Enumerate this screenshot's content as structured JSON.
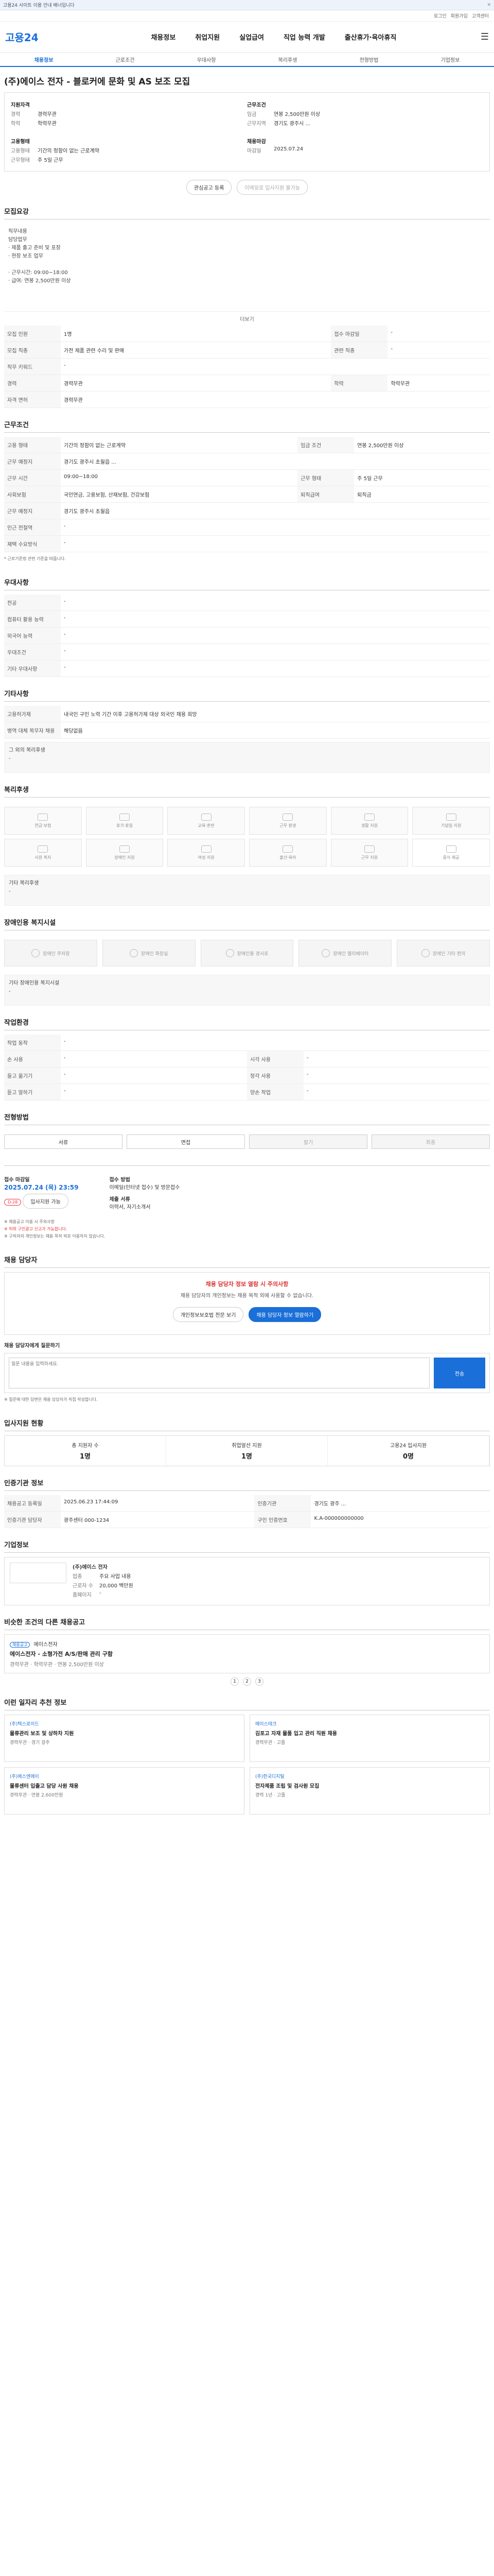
{
  "banner": {
    "text": "고용24 사이트 이용 안내 배너입니다"
  },
  "util": {
    "links": [
      "로그인",
      "회원가입",
      "고객센터"
    ]
  },
  "gnb": {
    "logo": "고용24",
    "menus": [
      "채용정보",
      "취업지원",
      "실업급여",
      "직업 능력 개발",
      "출산휴가·육아휴직"
    ]
  },
  "subnav": [
    "채용정보",
    "근로조건",
    "우대사항",
    "복리후생",
    "전형방법",
    "기업정보"
  ],
  "job": {
    "title": "(주)에이스 전자 - 블로커에 문화 및 AS 보조 모집",
    "left": [
      [
        "지원자격",
        ""
      ],
      [
        "경력",
        "경력무관"
      ],
      [
        "학력",
        "학력무관"
      ]
    ],
    "right": [
      [
        "근무조건",
        ""
      ],
      [
        "임금",
        "연봉 2,500만원 이상"
      ],
      [
        "근무지역",
        "경기도 광주시 ..."
      ]
    ],
    "left2": [
      [
        "고용형태",
        ""
      ],
      [
        "고용형태",
        "기간의 정함이 없는 근로계약"
      ],
      [
        "근무형태",
        "주 5일 근무"
      ]
    ],
    "right2": [
      [
        "채용마감",
        ""
      ],
      [
        "마감일",
        "2025.07.24"
      ]
    ],
    "btn_interest": "관심공고 등록",
    "btn_print": "이메일로 입사지원 불가능"
  },
  "recruit": {
    "heading": "모집요강",
    "summary": "직무내용\n담당업무\n· 제품 출고 준비 및 포장\n· 현장 보조 업무\n\n· 근무시간: 09:00~18:00\n· 급여: 연봉 2,500만원 이상",
    "more": "더보기",
    "rows": [
      [
        "모집 인원",
        "1명",
        "접수 마감일",
        "-"
      ],
      [
        "모집 직종",
        "가전 제품 관련 수리 및 판매",
        "관련 직종",
        "-"
      ],
      [
        "직무 키워드",
        "-",
        "",
        ""
      ],
      [
        "경력",
        "경력무관",
        "학력",
        "학력무관"
      ],
      [
        "자격 면허",
        "경력무관",
        "",
        ""
      ]
    ]
  },
  "cond": {
    "heading": "근무조건",
    "rows": [
      [
        "고용 형태",
        "기간의 정함이 없는 근로계약",
        "임금 조건",
        "연봉 2,500만원 이상"
      ],
      [
        "근무 예정지",
        "경기도 광주시 초월읍 ...",
        "",
        ""
      ],
      [
        "근무 시간",
        "09:00~18:00",
        "근무 형태",
        "주 5일 근무"
      ],
      [
        "사회보험",
        "국민연금, 고용보험, 산재보험, 건강보험",
        "퇴직급여",
        "퇴직금"
      ],
      [
        "근무 예정지",
        "경기도 광주시 초월읍",
        "",
        ""
      ],
      [
        "인근 전철역",
        "-",
        "",
        ""
      ],
      [
        "재택 수요방식",
        "-",
        "",
        ""
      ]
    ],
    "note": "* 근로기준법 관련 기준을 따릅니다."
  },
  "pref": {
    "heading": "우대사항",
    "rows": [
      [
        "전공",
        "-"
      ],
      [
        "컴퓨터 활용 능력",
        "-"
      ],
      [
        "외국어 능력",
        "-"
      ],
      [
        "우대조건",
        "-"
      ],
      [
        "기타 우대사항",
        "-"
      ]
    ]
  },
  "etc": {
    "heading": "기타사항",
    "rows": [
      [
        "고용허가제",
        "내국인 구인 노력 기간 이후 고용허가제 대상 외국인 채용 희망"
      ],
      [
        "병역 대체 복무자 채용",
        "해당없음"
      ]
    ],
    "extra": "그 외의 복리후생\n-"
  },
  "welfare": {
    "heading": "복리후생",
    "items": [
      "연금·보험",
      "휴가·휴일",
      "교육·훈련",
      "근무 환경",
      "생활 지원",
      "기념일 지원",
      "사원 복지",
      "장애인 지원",
      "여성 지원",
      "출산·육아",
      "근무 지원",
      "중식 제공"
    ],
    "extra": "기타 복리후생\n-"
  },
  "disab": {
    "heading": "장애인용 복지시설",
    "items": [
      "장애인 주차장",
      "장애인 화장실",
      "장애인용 경사로",
      "장애인 엘리베이터",
      "장애인 기타 편의"
    ],
    "extra": "기타 장애인용 복지시설\n-"
  },
  "env": {
    "heading": "작업환경",
    "rows": [
      [
        "작업 동작",
        "-",
        ""
      ],
      [
        "손 사용",
        "-",
        "시각 사용"
      ],
      [
        "들고 옮기기",
        "-",
        "청각 사용"
      ],
      [
        "듣고 말하기",
        "-",
        "양손 작업"
      ]
    ]
  },
  "process": {
    "heading": "전형방법",
    "steps": [
      "서류",
      "면접",
      "필기",
      "최종"
    ]
  },
  "apply": {
    "heading": "접수 마감일",
    "deadline": "2025.07.24 (목) 23:59",
    "dday": "D-28",
    "method_label": "접수 방법",
    "method": "이메일(인터넷 접수) 및 방문접수",
    "docs_label": "제출 서류",
    "docs": "이력서, 자기소개서",
    "btn_apply": "입사지원 가능",
    "notes": [
      "※ 채용공고 이용 시 주의사항",
      "※ 허위 구인광고 신고가 가능합니다.",
      "※ 구직자의 개인정보는 채용 목적 외로 이용하지 않습니다."
    ]
  },
  "mgr": {
    "heading": "채용 담당자",
    "warn": "채용 담당자 정보 열람 시 주의사항",
    "text": "채용 담당자의 개인정보는 채용 목적 외에 사용할 수 없습니다.",
    "btn1": "개인정보보호법 전문 보기",
    "btn2": "채용 담당자 정보 열람하기"
  },
  "qna": {
    "heading": "채용 담당자에게 질문하기",
    "placeholder": "질문 내용을 입력하세요.",
    "send": "전송",
    "note": "※ 질문에 대한 답변은 채용 담당자가 직접 작성합니다."
  },
  "stats": {
    "heading": "입사지원 현황",
    "items": [
      [
        "총 지원자 수",
        "1명"
      ],
      [
        "취업알선 지원 ",
        "1명"
      ],
      [
        "고용24 입사지원",
        "0명"
      ]
    ]
  },
  "info": {
    "heading": "인증기관 정보",
    "rows": [
      [
        "채용공고 등록일",
        "2025.06.23 17:44:09",
        "인증기관",
        "경기도 광주 ..."
      ],
      [
        "인증기관 담당자",
        "광주센터 000-1234",
        "구인 인증번호",
        "K.A-000000000000"
      ]
    ]
  },
  "company": {
    "heading": "기업정보",
    "name": "(주)에이스 전자",
    "rows": [
      [
        "업종",
        "주요 사업 내용"
      ],
      [
        "근로자 수",
        "20,000 백만원"
      ],
      [
        "홈페이지",
        "-"
      ]
    ]
  },
  "similar": {
    "heading": "비슷한 조건의 다른 채용공고",
    "cotag": "채용공고",
    "coname": "에이스전자",
    "title": "에이스전자 - 소형가전 A/S/판매 관리 구함",
    "meta": "경력무관 · 학력무관 · 연봉 2,500만원 이상",
    "pages": [
      "1",
      "2",
      "3"
    ]
  },
  "recent": {
    "heading": "이런 일자리 추천 정보",
    "cards": [
      {
        "co": "(주)텍스로이드",
        "title": "물류관리 보조 및 상하차 지원",
        "meta": "경력무관 · 경기 광주"
      },
      {
        "co": "에이스테크",
        "title": "김포고 자재 물품 입고 관리 직원 채용",
        "meta": "경력무관 · 고졸"
      },
      {
        "co": "(주)에스엔에이",
        "title": "물류센터 입출고 담당 사원 채용",
        "meta": "경력무관 · 연봉 2,600만원"
      },
      {
        "co": "(주)한국디지털",
        "title": "전자제품 조립 및 검사원 모집",
        "meta": "경력 1년 · 고졸"
      }
    ]
  }
}
